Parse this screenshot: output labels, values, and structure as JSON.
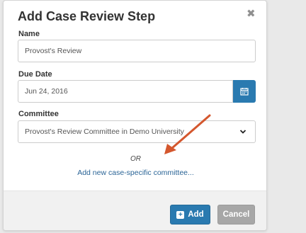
{
  "dialog": {
    "title": "Add Case Review Step",
    "close_icon": "close-icon"
  },
  "form": {
    "name": {
      "label": "Name",
      "value": "Provost's Review"
    },
    "due_date": {
      "label": "Due Date",
      "value": "Jun 24, 2016",
      "calendar_icon": "calendar-icon"
    },
    "committee": {
      "label": "Committee",
      "selected": "Provost's Review Committee in Demo University",
      "dropdown_icon": "chevron-down-icon"
    },
    "or_text": "OR",
    "add_new_link": "Add new case-specific committee..."
  },
  "footer": {
    "add_label": "Add",
    "cancel_label": "Cancel"
  },
  "colors": {
    "primary": "#2a7ab0",
    "link": "#2a6496",
    "annotation_arrow": "#d4572e",
    "cancel": "#a7a7a7"
  }
}
